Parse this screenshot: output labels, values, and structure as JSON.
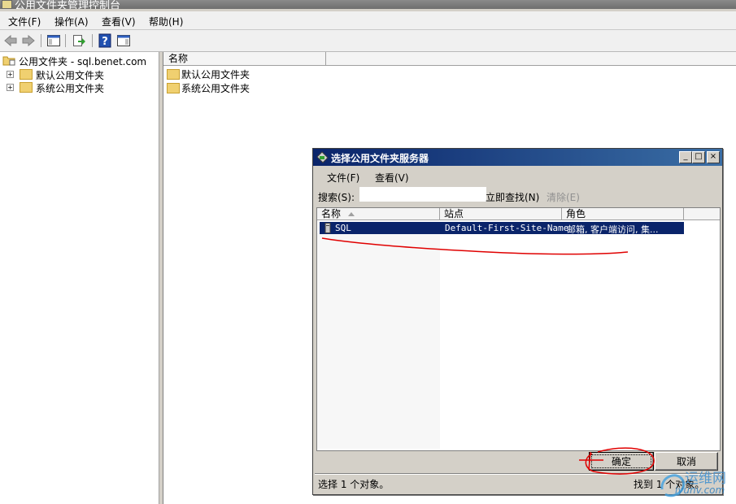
{
  "window": {
    "title": "公用文件夹管理控制台"
  },
  "menubar": [
    {
      "label": "文件(F)"
    },
    {
      "label": "操作(A)"
    },
    {
      "label": "查看(V)"
    },
    {
      "label": "帮助(H)"
    }
  ],
  "toolbar": {
    "buttons": [
      "back-icon",
      "forward-icon",
      "show-hide-tree-icon",
      "export-list-icon",
      "help-icon",
      "show-hide-action-pane-icon"
    ]
  },
  "tree": {
    "root": "公用文件夹 - sql.benet.com",
    "children": [
      {
        "label": "默认公用文件夹",
        "expander": "+"
      },
      {
        "label": "系统公用文件夹",
        "expander": "+"
      }
    ]
  },
  "list": {
    "columns": [
      "名称"
    ],
    "items": [
      "默认公用文件夹",
      "系统公用文件夹"
    ]
  },
  "dialog": {
    "title": "选择公用文件夹服务器",
    "controls": {
      "minimize": "_",
      "maximize": "□",
      "close": "×"
    },
    "menu": [
      {
        "label": "文件(F)"
      },
      {
        "label": "查看(V)"
      }
    ],
    "search_label": "搜索(S):",
    "search_value": "",
    "find_now": "立即查找(N)",
    "clear": "清除(E)",
    "columns": [
      "名称",
      "站点",
      "角色"
    ],
    "rows": [
      {
        "name": "SQL",
        "site": "Default-First-Site-Name",
        "role": "邮箱, 客户端访问, 集..."
      }
    ],
    "ok": "确定",
    "cancel": "取消",
    "status_left": "选择 1 个对象。",
    "status_right": "找到 1 个对象。"
  },
  "watermark": {
    "text": "运维网",
    "url": "iyunv.com"
  },
  "annotation_color": "#e00000"
}
